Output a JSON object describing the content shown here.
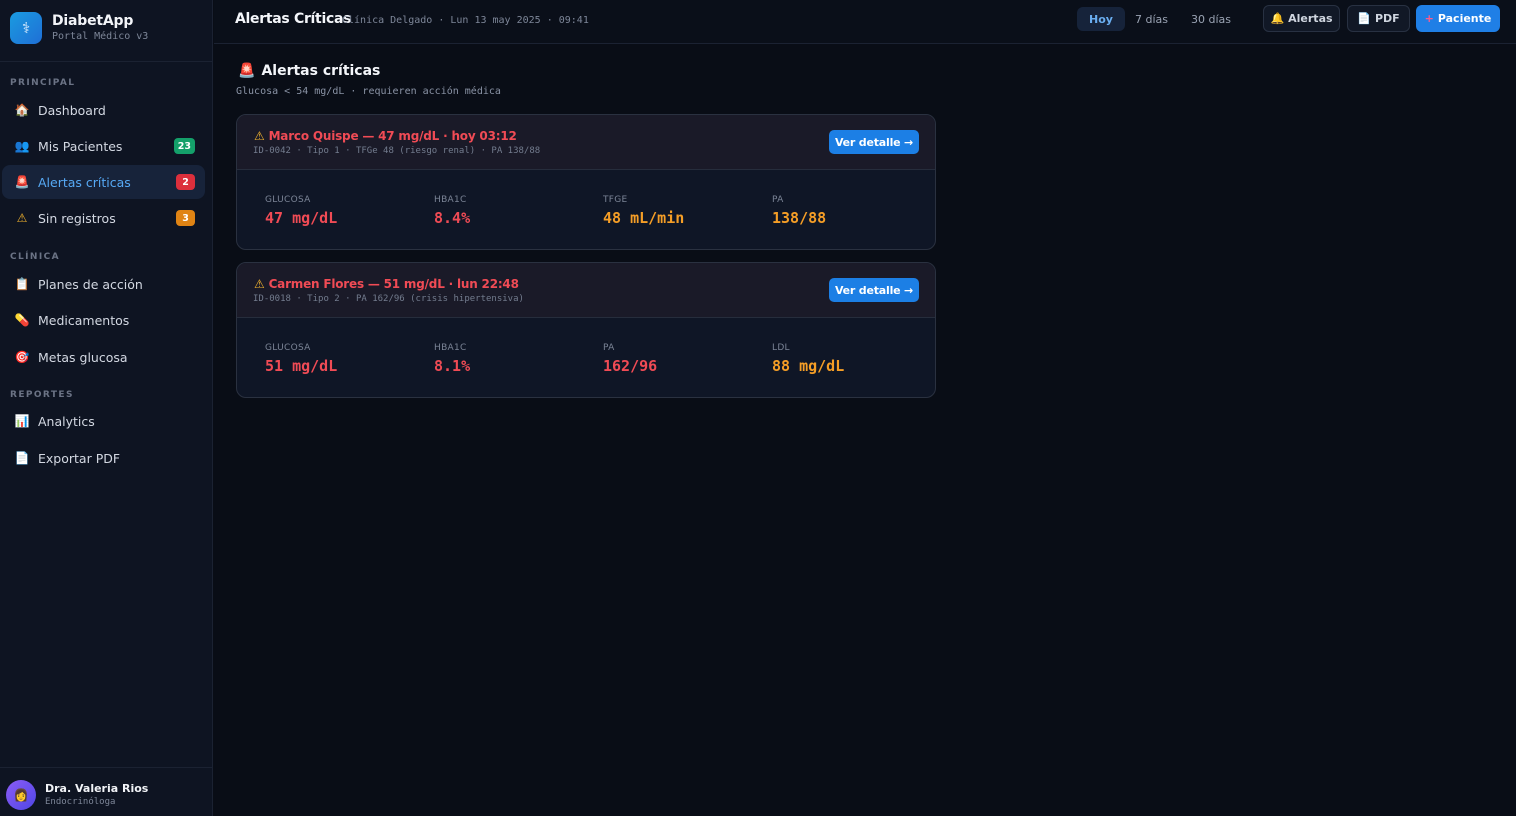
{
  "brand": {
    "name": "DiabetApp",
    "subtitle": "Portal Médico v3",
    "logo_icon": "stethoscope-icon"
  },
  "sidebar": {
    "sections": [
      {
        "label": "PRINCIPAL"
      },
      {
        "label": "CLÍNICA"
      },
      {
        "label": "REPORTES"
      }
    ],
    "items": [
      {
        "label": "Dashboard",
        "icon": "🏠",
        "icon_name": "home-icon"
      },
      {
        "label": "Mis Pacientes",
        "icon": "👥",
        "icon_name": "patients-icon",
        "badge": "23",
        "badge_color": "#14a06a"
      },
      {
        "label": "Alertas críticas",
        "icon": "🚨",
        "icon_name": "siren-icon",
        "badge": "2",
        "badge_color": "#dc2f3c",
        "active": true
      },
      {
        "label": "Sin registros",
        "icon": "⚠",
        "icon_name": "warning-icon",
        "badge": "3",
        "badge_color": "#e08414"
      },
      {
        "label": "Planes de acción",
        "icon": "📋",
        "icon_name": "clipboard-icon"
      },
      {
        "label": "Medicamentos",
        "icon": "💊",
        "icon_name": "pill-icon"
      },
      {
        "label": "Metas glucosa",
        "icon": "🎯",
        "icon_name": "target-icon"
      },
      {
        "label": "Analytics",
        "icon": "📊",
        "icon_name": "bar-chart-icon"
      },
      {
        "label": "Exportar PDF",
        "icon": "📄",
        "icon_name": "document-icon"
      }
    ]
  },
  "user": {
    "name": "Dra. Valeria Rios",
    "role": "Endocrinóloga",
    "avatar_icon": "👩"
  },
  "topbar": {
    "title": "Alertas Críticas",
    "meta": "Clínica Delgado · Lun 13 may 2025 · 09:41",
    "ranges": [
      "Hoy",
      "7 días",
      "30 días"
    ],
    "active_range": "Hoy",
    "alerts_label": "Alertas",
    "pdf_label": "PDF",
    "patient_label": "Paciente",
    "bell_icon": "🔔",
    "doc_icon": "📄",
    "plus_icon": "+"
  },
  "main": {
    "title": "Alertas críticas",
    "title_icon": "🚨",
    "subtitle": "Glucosa < 54 mg/dL · requieren acción médica"
  },
  "alerts": [
    {
      "title": "Marco Quispe — 47 mg/dL · hoy 03:12",
      "subtitle": "ID-0042 · Tipo 1 · TFGe 48 (riesgo renal) · PA 138/88",
      "button": "Ver detalle →",
      "metrics": [
        {
          "label": "GLUCOSA",
          "value": "47 mg/dL",
          "color": "red"
        },
        {
          "label": "HBA1C",
          "value": "8.4%",
          "color": "red"
        },
        {
          "label": "TFGE",
          "value": "48 mL/min",
          "color": "orange"
        },
        {
          "label": "PA",
          "value": "138/88",
          "color": "orange"
        }
      ]
    },
    {
      "title": "Carmen Flores — 51 mg/dL · lun 22:48",
      "subtitle": "ID-0018 · Tipo 2 · PA 162/96 (crisis hipertensiva)",
      "button": "Ver detalle →",
      "metrics": [
        {
          "label": "GLUCOSA",
          "value": "51 mg/dL",
          "color": "red"
        },
        {
          "label": "HBA1C",
          "value": "8.1%",
          "color": "red"
        },
        {
          "label": "PA",
          "value": "162/96",
          "color": "red"
        },
        {
          "label": "LDL",
          "value": "88 mg/dL",
          "color": "orange"
        }
      ]
    }
  ],
  "colors": {
    "accent": "#1f7fe6",
    "danger": "#f04b55",
    "warning": "#f59e26"
  }
}
